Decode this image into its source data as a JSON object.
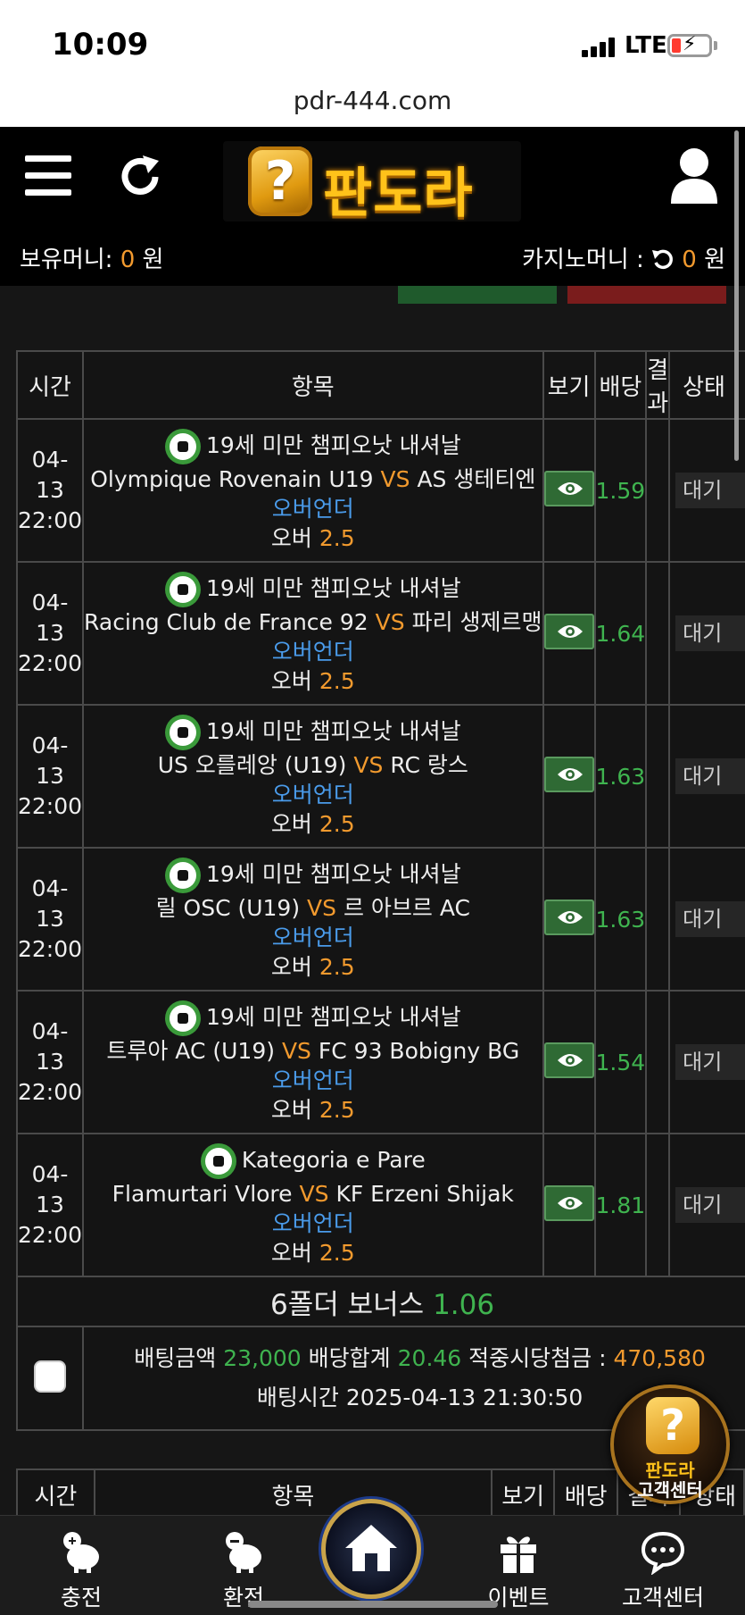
{
  "status_bar": {
    "time": "10:09",
    "network": "LTE"
  },
  "url_bar": {
    "domain": "pdr-444.com"
  },
  "header": {
    "logo_text": "판도라",
    "logo_badge": "?",
    "balance_label": "보유머니:",
    "balance_value": "0",
    "currency": "원",
    "casino_label": "카지노머니 :",
    "casino_value": "0"
  },
  "table": {
    "headers": {
      "time": "시간",
      "item": "항목",
      "view": "보기",
      "odds": "배당",
      "result": "결과",
      "status": "상태"
    },
    "rows": [
      {
        "date": "04-13",
        "time": "22:00",
        "league": "19세 미만 챔피오낫 내셔날",
        "home": "Olympique Rovenain U19",
        "vs": "VS",
        "away": "AS 생테티엔",
        "market": "오버언더",
        "pick": "오버",
        "line": "2.5",
        "odds": "1.59",
        "result": "",
        "status": "대기"
      },
      {
        "date": "04-13",
        "time": "22:00",
        "league": "19세 미만 챔피오낫 내셔날",
        "home": "Racing Club de France 92",
        "vs": "VS",
        "away": "파리 생제르맹",
        "market": "오버언더",
        "pick": "오버",
        "line": "2.5",
        "odds": "1.64",
        "result": "",
        "status": "대기"
      },
      {
        "date": "04-13",
        "time": "22:00",
        "league": "19세 미만 챔피오낫 내셔날",
        "home": "US 오를레앙 (U19)",
        "vs": "VS",
        "away": "RC 랑스",
        "market": "오버언더",
        "pick": "오버",
        "line": "2.5",
        "odds": "1.63",
        "result": "",
        "status": "대기"
      },
      {
        "date": "04-13",
        "time": "22:00",
        "league": "19세 미만 챔피오낫 내셔날",
        "home": "릴 OSC (U19)",
        "vs": "VS",
        "away": "르 아브르 AC",
        "market": "오버언더",
        "pick": "오버",
        "line": "2.5",
        "odds": "1.63",
        "result": "",
        "status": "대기"
      },
      {
        "date": "04-13",
        "time": "22:00",
        "league": "19세 미만 챔피오낫 내셔날",
        "home": "트루아 AC (U19)",
        "vs": "VS",
        "away": "FC 93 Bobigny BG",
        "market": "오버언더",
        "pick": "오버",
        "line": "2.5",
        "odds": "1.54",
        "result": "",
        "status": "대기"
      },
      {
        "date": "04-13",
        "time": "22:00",
        "league": "Kategoria e Pare",
        "home": "Flamurtari Vlore",
        "vs": "VS",
        "away": "KF Erzeni Shijak",
        "market": "오버언더",
        "pick": "오버",
        "line": "2.5",
        "odds": "1.81",
        "result": "",
        "status": "대기"
      }
    ],
    "bonus_label": "6폴더 보너스",
    "bonus_value": "1.06",
    "summary": {
      "bet_amount_label": "배팅금액",
      "bet_amount": "23,000",
      "total_odds_label": "배당합계",
      "total_odds": "20.46",
      "payout_label": "적중시당첨금 :",
      "payout": "470,580",
      "bet_time_label": "배팅시간",
      "bet_time": "2025-04-13 21:30:50"
    }
  },
  "floating_cs": {
    "line1": "판도라",
    "line2": "고객센터"
  },
  "bottom_nav": [
    {
      "label": "충전",
      "icon": "piggy-plus-icon"
    },
    {
      "label": "환전",
      "icon": "piggy-minus-icon"
    },
    {
      "label": "",
      "icon": "home-icon"
    },
    {
      "label": "이벤트",
      "icon": "gift-icon"
    },
    {
      "label": "고객센터",
      "icon": "chat-icon"
    }
  ],
  "colors": {
    "accent_orange": "#f29a2e",
    "odds_green": "#3fb34f",
    "market_blue": "#4a9bea",
    "background": "#161616"
  }
}
